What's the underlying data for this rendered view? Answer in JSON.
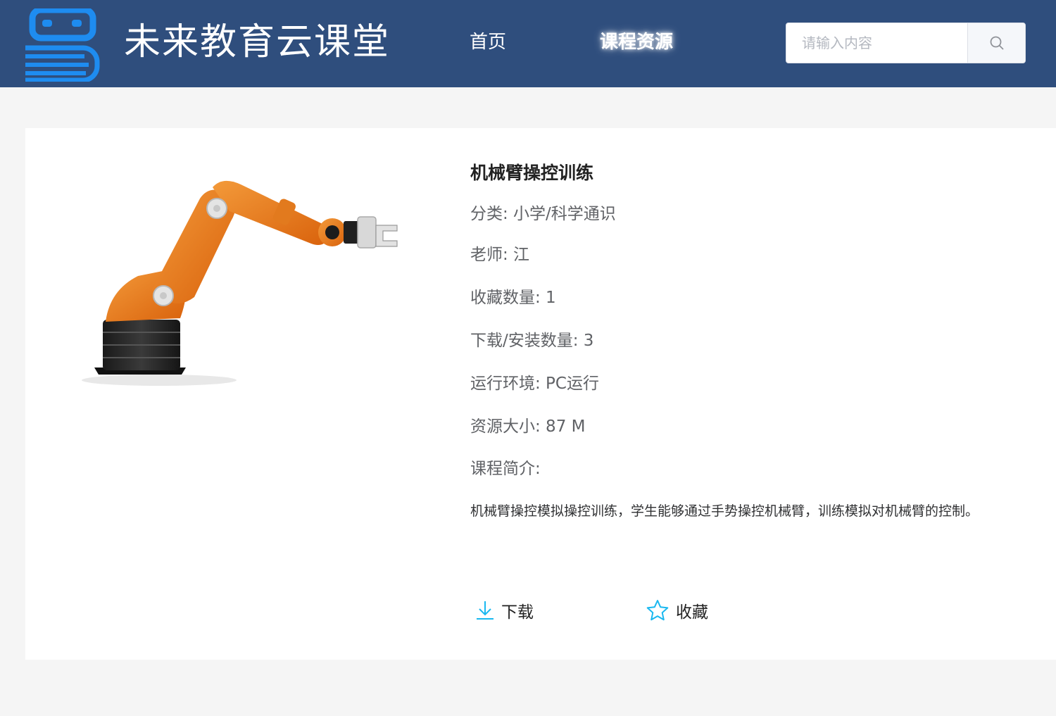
{
  "header": {
    "site_title": "未来教育云课堂",
    "nav": [
      {
        "label": "首页",
        "active": false
      },
      {
        "label": "课程资源",
        "active": true
      }
    ],
    "search": {
      "placeholder": "请输入内容",
      "value": ""
    },
    "colors": {
      "background": "#2f4e7d",
      "logo": "#1e8cf0"
    }
  },
  "course": {
    "title": "机械臂操控训练",
    "category": "分类: 小学/科学通识",
    "teacher": "老师: 江",
    "favorites": "收藏数量: 1",
    "downloads": "下载/安装数量: 3",
    "environment": "运行环境: PC运行",
    "size": "资源大小: 87 M",
    "intro_label": "课程简介:",
    "intro": "机械臂操控模拟操控训练，学生能够通过手势操控机械臂，训练模拟对机械臂的控制。",
    "image_icon": "robot-arm-image"
  },
  "actions": {
    "download_label": "下载",
    "favorite_label": "收藏",
    "download_icon": "download-icon",
    "favorite_icon": "star-icon",
    "icon_color": "#19b8f0"
  }
}
